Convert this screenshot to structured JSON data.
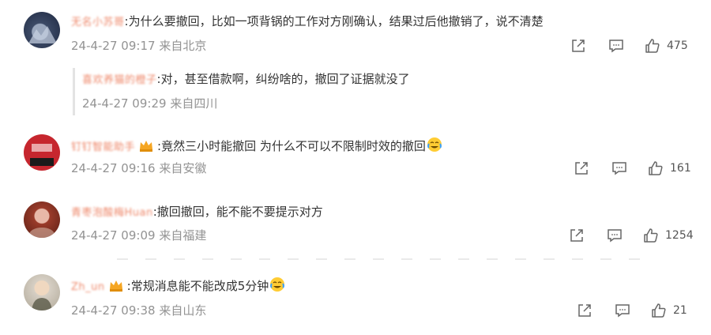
{
  "comments": [
    {
      "username": "无名小苏哥",
      "text": "为什么要撤回，比如一项背锅的工作对方刚确认，结果过后他撤销了，说不清楚",
      "time": "24-4-27 09:17",
      "location": "来自北京",
      "likes": "475",
      "replies": [
        {
          "username": "喜欢养猫的橙子",
          "text": "对，甚至借款啊，纠纷啥的，撤回了证据就没了",
          "time": "24-4-27 09:29",
          "location": "来自四川"
        }
      ]
    },
    {
      "username": "钉钉智能助手",
      "text": "竟然三小时能撤回 为什么不可以不限制时效的撤回",
      "time": "24-4-27 09:16",
      "location": "来自安徽",
      "likes": "161"
    },
    {
      "username": "青枣泡酸梅Huan",
      "text": "撤回撤回，能不能不要提示对方",
      "time": "24-4-27 09:09",
      "location": "来自福建",
      "likes": "1254"
    },
    {
      "username": "Zh_un",
      "text": "常规消息能不能改成5分钟",
      "time": "24-4-27 09:38",
      "location": "来自山东",
      "likes": "21"
    }
  ],
  "colors": {
    "username": "#eb7350",
    "meta": "#939393",
    "text": "#333333"
  },
  "icons": [
    "share-icon",
    "comment-icon",
    "like-icon",
    "crying-laughing-emoji",
    "vip-crown-icon"
  ]
}
